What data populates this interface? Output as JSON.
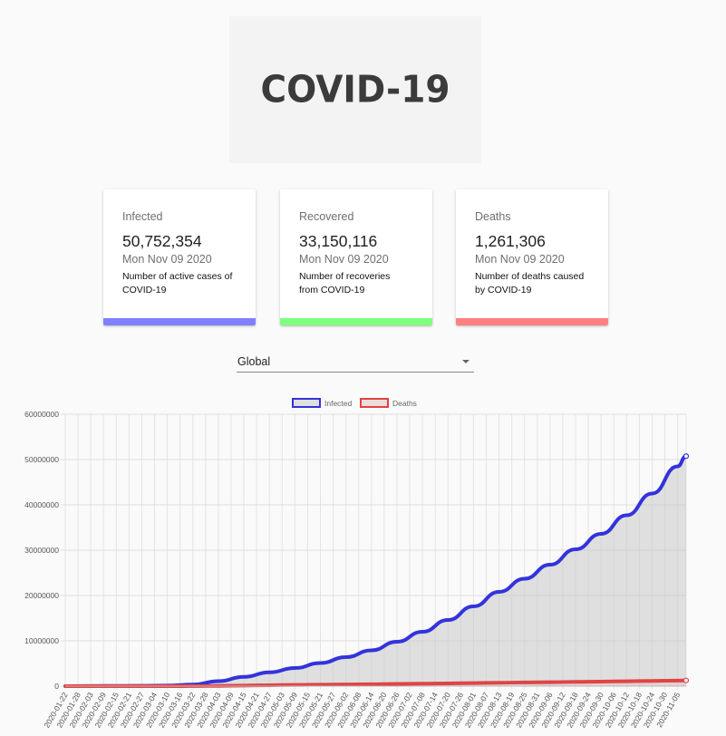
{
  "logo": {
    "text": "COVID-19"
  },
  "cards": [
    {
      "title": "Infected",
      "value": "50,752,354",
      "date": "Mon Nov 09 2020",
      "desc_line1": "Number of active cases of",
      "desc_line2": "COVID-19",
      "color": "#8080ff"
    },
    {
      "title": "Recovered",
      "value": "33,150,116",
      "date": "Mon Nov 09 2020",
      "desc_line1": "Number of recoveries",
      "desc_line2": "from COVID-19",
      "color": "#80ff80"
    },
    {
      "title": "Deaths",
      "value": "1,261,306",
      "date": "Mon Nov 09 2020",
      "desc_line1": "Number of deaths caused",
      "desc_line2": "by COVID-19",
      "color": "#ff8080"
    }
  ],
  "country_select": {
    "value": "Global",
    "icon": "caret-down-icon"
  },
  "chart_data": {
    "type": "line",
    "title": "",
    "xlabel": "",
    "ylabel": "",
    "ylim": [
      0,
      60000000
    ],
    "yticks": [
      0,
      10000000,
      20000000,
      30000000,
      40000000,
      50000000,
      60000000
    ],
    "grid": true,
    "legend_position": "top",
    "x_tick_labels": [
      "2020-01-22",
      "2020-01-28",
      "2020-02-03",
      "2020-02-09",
      "2020-02-15",
      "2020-02-21",
      "2020-02-27",
      "2020-03-04",
      "2020-03-10",
      "2020-03-16",
      "2020-03-22",
      "2020-03-28",
      "2020-04-03",
      "2020-04-09",
      "2020-04-15",
      "2020-04-21",
      "2020-04-27",
      "2020-05-03",
      "2020-05-09",
      "2020-05-15",
      "2020-05-21",
      "2020-05-27",
      "2020-06-02",
      "2020-06-08",
      "2020-06-14",
      "2020-06-20",
      "2020-06-26",
      "2020-07-02",
      "2020-07-08",
      "2020-07-14",
      "2020-07-20",
      "2020-07-26",
      "2020-08-01",
      "2020-08-07",
      "2020-08-13",
      "2020-08-19",
      "2020-08-25",
      "2020-08-31",
      "2020-09-06",
      "2020-09-12",
      "2020-09-18",
      "2020-09-24",
      "2020-09-30",
      "2020-10-06",
      "2020-10-12",
      "2020-10-18",
      "2020-10-24",
      "2020-10-30",
      "2020-11-05"
    ],
    "series": [
      {
        "name": "Infected",
        "color": "#3333dd",
        "fill": "rgba(200,200,200,0.55)",
        "points": [
          [
            "2020-01-22",
            555
          ],
          [
            "2020-02-09",
            40000
          ],
          [
            "2020-02-27",
            83000
          ],
          [
            "2020-03-10",
            120000
          ],
          [
            "2020-03-22",
            340000
          ],
          [
            "2020-04-03",
            1100000
          ],
          [
            "2020-04-15",
            2050000
          ],
          [
            "2020-04-27",
            3050000
          ],
          [
            "2020-05-09",
            4000000
          ],
          [
            "2020-05-21",
            5100000
          ],
          [
            "2020-06-02",
            6400000
          ],
          [
            "2020-06-14",
            7900000
          ],
          [
            "2020-06-26",
            9800000
          ],
          [
            "2020-07-08",
            12000000
          ],
          [
            "2020-07-20",
            14600000
          ],
          [
            "2020-08-01",
            17600000
          ],
          [
            "2020-08-13",
            20800000
          ],
          [
            "2020-08-25",
            23700000
          ],
          [
            "2020-09-06",
            26800000
          ],
          [
            "2020-09-18",
            30200000
          ],
          [
            "2020-09-30",
            33600000
          ],
          [
            "2020-10-12",
            37700000
          ],
          [
            "2020-10-24",
            42500000
          ],
          [
            "2020-11-05",
            48500000
          ],
          [
            "2020-11-09",
            50752354
          ]
        ]
      },
      {
        "name": "Deaths",
        "color": "#e04444",
        "fill": "rgba(230,200,200,0.6)",
        "points": [
          [
            "2020-01-22",
            17
          ],
          [
            "2020-03-10",
            4300
          ],
          [
            "2020-03-22",
            15000
          ],
          [
            "2020-04-03",
            60000
          ],
          [
            "2020-04-15",
            137000
          ],
          [
            "2020-04-27",
            210000
          ],
          [
            "2020-05-09",
            280000
          ],
          [
            "2020-05-21",
            330000
          ],
          [
            "2020-06-02",
            380000
          ],
          [
            "2020-06-14",
            430000
          ],
          [
            "2020-06-26",
            495000
          ],
          [
            "2020-07-08",
            550000
          ],
          [
            "2020-07-20",
            610000
          ],
          [
            "2020-08-01",
            685000
          ],
          [
            "2020-08-13",
            755000
          ],
          [
            "2020-08-25",
            820000
          ],
          [
            "2020-09-06",
            880000
          ],
          [
            "2020-09-18",
            945000
          ],
          [
            "2020-09-30",
            1010000
          ],
          [
            "2020-10-12",
            1080000
          ],
          [
            "2020-10-24",
            1150000
          ],
          [
            "2020-11-05",
            1235000
          ],
          [
            "2020-11-09",
            1261306
          ]
        ]
      }
    ]
  }
}
